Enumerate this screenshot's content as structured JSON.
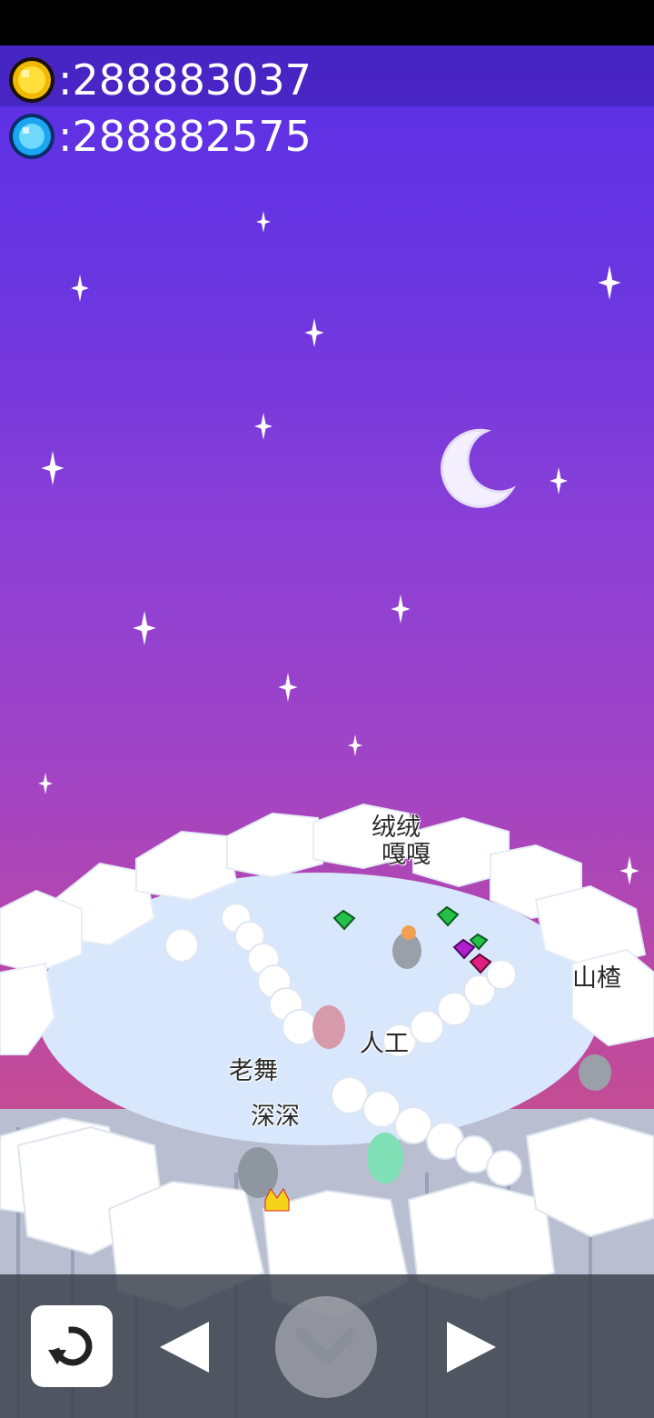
{
  "hud": {
    "coins": ":288883037",
    "gems": ":288882575",
    "coin_icon": "gold-coin-icon",
    "gem_icon": "blue-gem-icon"
  },
  "players": {
    "p1": "绒绒",
    "p2": "嘎嘎",
    "p3": "山楂",
    "p4": "人工",
    "p5": "老舞",
    "p6": "深深"
  },
  "controls": {
    "reset_icon": "undo-icon",
    "left_icon": "left-arrow-icon",
    "confirm_icon": "checkmark-icon",
    "right_icon": "right-arrow-icon"
  },
  "colors": {
    "sky_top": "#5a2fe6",
    "sky_bottom": "#cf6f9a",
    "snow": "#ffffff",
    "ice": "#d6e6fb"
  }
}
